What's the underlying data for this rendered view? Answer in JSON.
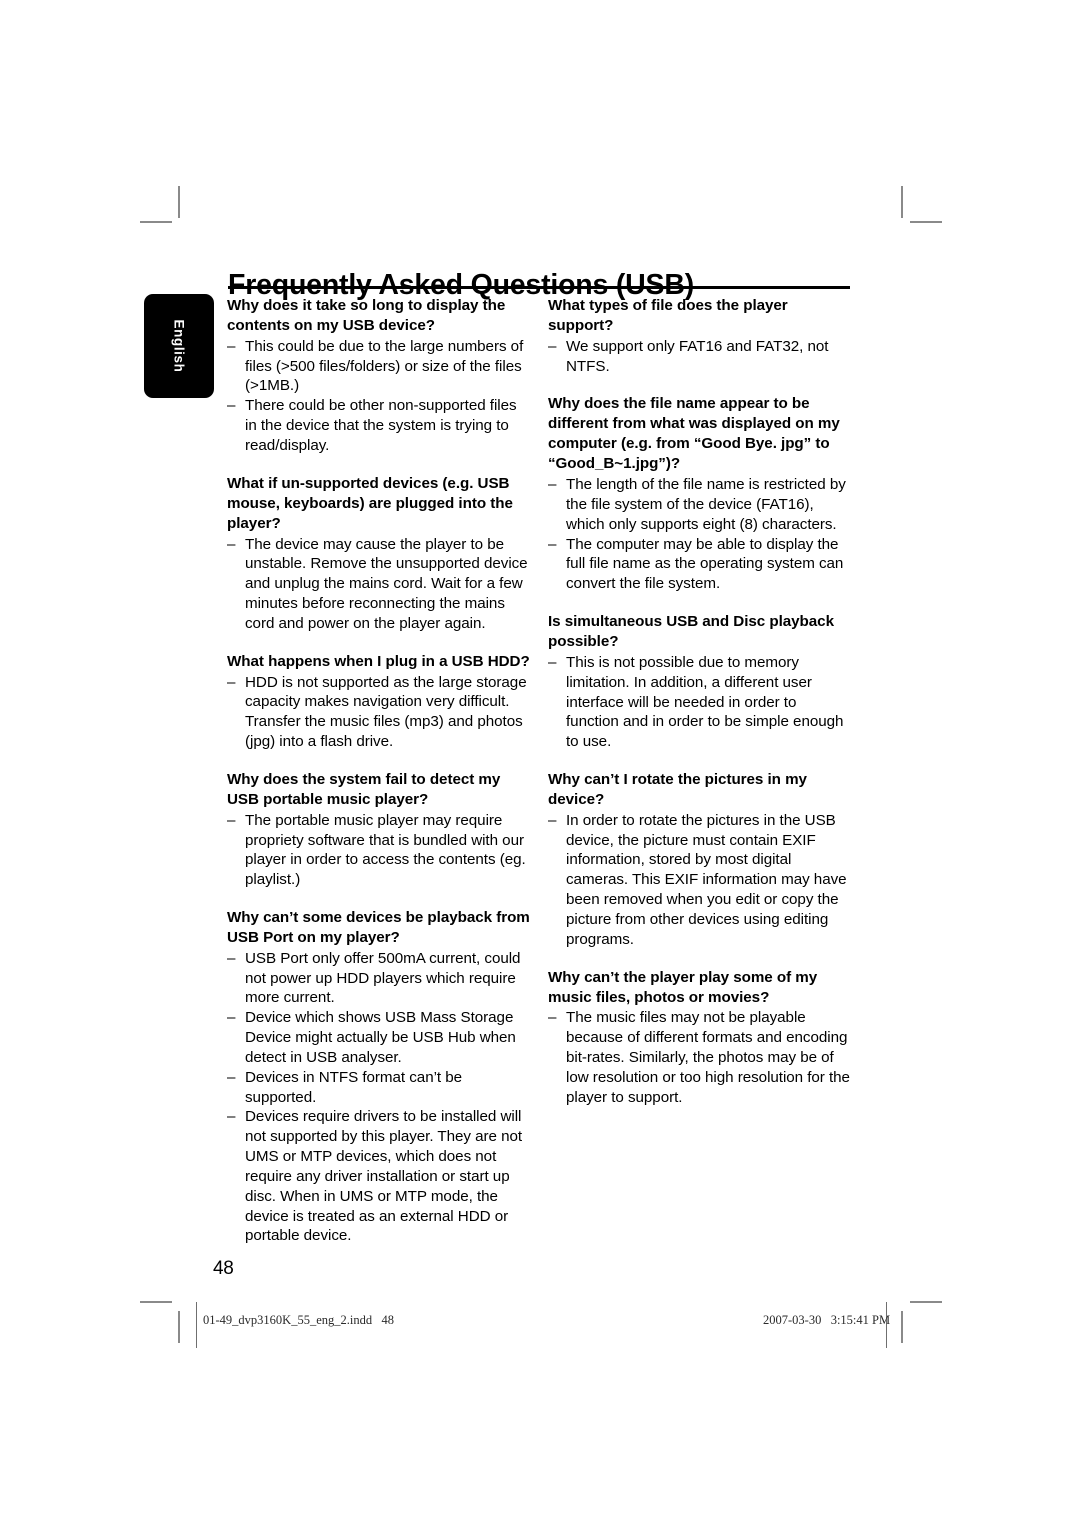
{
  "document": {
    "title": "Frequently Asked Questions (USB)",
    "language_tab": "English",
    "page_number": "48"
  },
  "footer": {
    "filename": "01-49_dvp3160K_55_eng_2.indd   48",
    "timestamp": "2007-03-30   3:15:41 PM"
  },
  "bullet": {
    "dash": "–"
  },
  "columns": {
    "left": [
      {
        "question": "Why does it take so long to display the contents on my USB device?",
        "answers": [
          "This could be due to the large numbers of files (>500 files/folders) or size of the files (>1MB.)",
          "There could be other non-supported files in the device that the system is trying to read/display."
        ]
      },
      {
        "question": "What if un-supported devices (e.g. USB mouse, keyboards) are plugged into the player?",
        "answers": [
          "The device may cause the player to be unstable.  Remove the unsupported device and unplug the mains cord.  Wait for a few minutes before reconnecting the mains cord and power on the player again."
        ]
      },
      {
        "question": "What happens when I plug in a USB HDD?",
        "answers": [
          "HDD is not supported as the large storage capacity makes navigation very difficult.  Transfer the music files (mp3) and photos (jpg) into a flash drive."
        ]
      },
      {
        "question": "Why does the system fail to detect my USB portable music player?",
        "answers": [
          "The portable music player may require propriety software that is bundled with our player in order to access the contents (eg. playlist.)"
        ]
      },
      {
        "question": "Why can’t some devices be playback from USB Port on my player?",
        "answers": [
          "USB Port only offer 500mA current, could not power up HDD players which require more current.",
          "Device which shows USB Mass Storage Device might actually be USB Hub when detect in USB analyser.",
          "Devices in NTFS format can’t be supported.",
          "Devices require drivers to be installed will not supported by this player. They are not UMS or MTP devices, which does not require any driver installation or start up disc. When in UMS or MTP mode, the device is treated as an external HDD or portable device."
        ]
      }
    ],
    "right": [
      {
        "question": "What types of file does the player support?",
        "answers": [
          "We support only FAT16 and FAT32, not NTFS."
        ]
      },
      {
        "question": "Why does the file name appear to be different from what was displayed on my computer (e.g. from “Good Bye. jpg” to “Good_B~1.jpg”)?",
        "answers": [
          "The length of the file name is restricted by the file system of the device (FAT16), which only supports eight (8) characters.",
          "The computer may be able to display the full file name as the operating system can convert the file system."
        ]
      },
      {
        "question": "Is simultaneous USB and Disc playback possible?",
        "answers": [
          "This is not possible due to memory limitation.  In addition, a different user interface will be needed in order to function and in order to be simple enough to use."
        ]
      },
      {
        "question": "Why can’t I rotate the pictures in my device?",
        "answers": [
          "In order to rotate the pictures in the USB device, the picture must contain EXIF information, stored by most digital cameras.  This EXIF information may have been removed when you edit or copy the picture from other devices using editing programs."
        ]
      },
      {
        "question": "Why can’t the player play some of my music files, photos or movies?",
        "answers": [
          "The music files may not be playable because of different formats and encoding bit-rates.  Similarly, the photos may be of low resolution or too high resolution for the player to support."
        ]
      }
    ]
  }
}
